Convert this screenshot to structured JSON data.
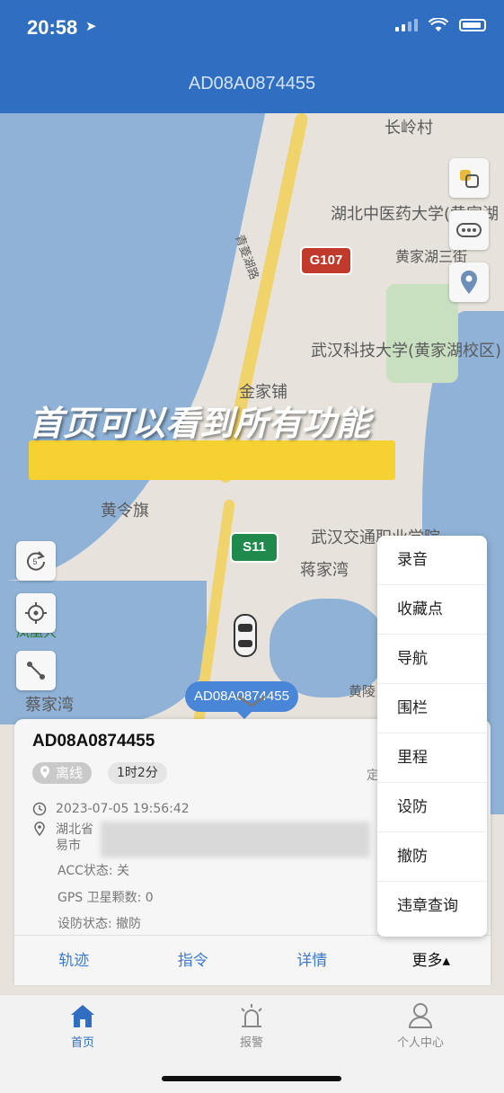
{
  "status_bar": {
    "time": "20:58",
    "location_glyph": "➤"
  },
  "nav": {
    "title": "AD08A0874455"
  },
  "map": {
    "labels": {
      "changling": "长岭村",
      "hubei_tcm": "湖北中医药大学(黄家湖",
      "qingling": "青菱湖路",
      "g107": "G107",
      "huangjiahu3": "黄家湖三街",
      "wust": "武汉科技大学(黄家湖校区)",
      "jinjiapu": "金家铺",
      "huanglingqi": "黄令旗",
      "whvtc": "武汉交通职业学院",
      "s11": "S11",
      "jiangjiawan": "蒋家湾",
      "caijiawan": "蔡家湾",
      "huangling": "黄陵",
      "fengbei": "凤凰大"
    }
  },
  "overlay": {
    "caption": "首页可以看到所有功能"
  },
  "marker": {
    "label": "AD08A0874455"
  },
  "panel": {
    "device_id": "AD08A0874455",
    "status": "离线",
    "duration": "1时2分",
    "timestamp": "2023-07-05 19:56:42",
    "address_line1": "湖北省",
    "address_line2": "易市",
    "acc": "ACC状态: 关",
    "gps": "GPS 卫星颗数: 0",
    "defense": "设防状态: 撤防",
    "right_hint": "定",
    "actions": [
      "轨迹",
      "指令",
      "详情",
      "更多▴"
    ]
  },
  "dropdown": {
    "items": [
      "录音",
      "收藏点",
      "导航",
      "围栏",
      "里程",
      "设防",
      "撤防",
      "违章查询"
    ]
  },
  "tabbar": {
    "tabs": [
      "首页",
      "报警",
      "个人中心"
    ]
  },
  "colors": {
    "brand": "#2f6ec0",
    "marker": "#4a86d8",
    "highlight": "#f5d232"
  }
}
